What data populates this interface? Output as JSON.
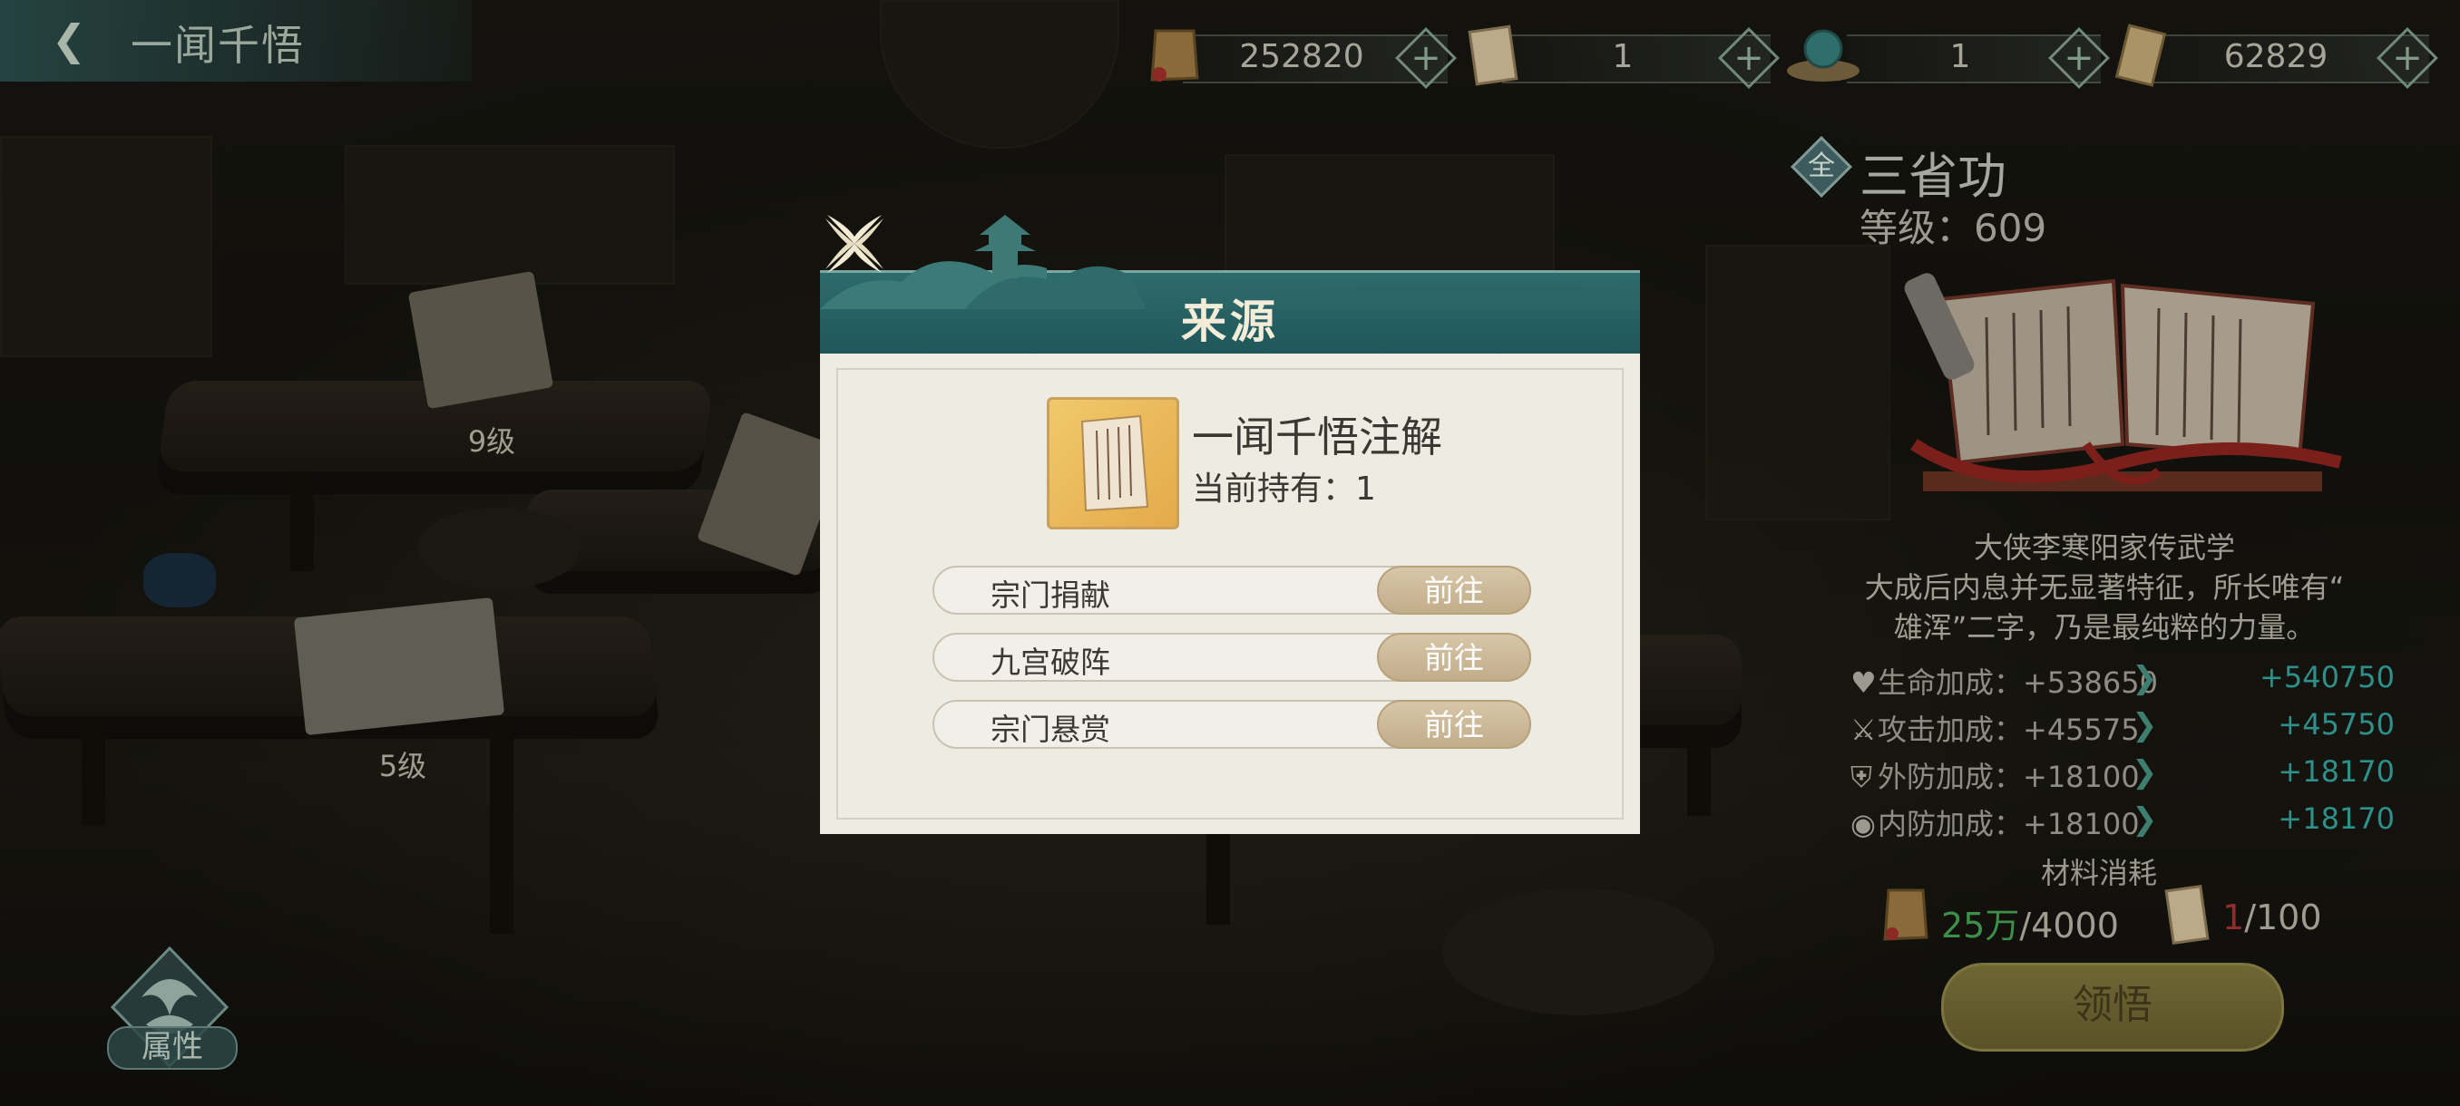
{
  "header": {
    "title": "一闻千悟"
  },
  "currencies": [
    {
      "icon": "seal-token-icon",
      "value": "252820"
    },
    {
      "icon": "scroll-note-icon",
      "value": "1"
    },
    {
      "icon": "jade-artifact-icon",
      "value": "1"
    },
    {
      "icon": "manual-book-icon",
      "value": "62829"
    }
  ],
  "scene": {
    "item_levels": [
      "9级",
      "5级"
    ],
    "attr_label": "属性"
  },
  "kungfu": {
    "badge": "全",
    "name": "三省功",
    "level_text": "等级：609",
    "description": [
      "大侠李寒阳家传武学",
      "大成后内息并无显著特征，所长唯有“",
      "雄浑”二字，乃是最纯粹的力量。"
    ],
    "stats": [
      {
        "icon": "heart-icon",
        "label": "生命加成：+538650",
        "next": "+540750"
      },
      {
        "icon": "sword-icon",
        "label": "攻击加成：+45575",
        "next": "+45750"
      },
      {
        "icon": "shield-icon",
        "label": "外防加成：+18100",
        "next": "+18170"
      },
      {
        "icon": "inner-shield-icon",
        "label": "内防加成：+18100",
        "next": "+18170"
      }
    ],
    "materials_title": "材料消耗",
    "materials": [
      {
        "icon": "seal-token-icon",
        "have": "25万",
        "need": "/4000",
        "enough": true
      },
      {
        "icon": "scroll-note-icon",
        "have": "1",
        "need": "/100",
        "enough": false
      }
    ],
    "comprehend_label": "领悟"
  },
  "modal": {
    "title": "来源",
    "item_name": "一闻千悟注解",
    "owned_text": "当前持有：1",
    "sources": [
      {
        "name": "宗门捐献",
        "action": "前往"
      },
      {
        "name": "九宫破阵",
        "action": "前往"
      },
      {
        "name": "宗门悬赏",
        "action": "前往"
      }
    ]
  },
  "colors": {
    "modal_header": "#2e6b6d",
    "go_button": "#c2ad8a",
    "stat_next": "#2f8f8a",
    "enough": "#3e8f4a",
    "not_enough": "#8f2d2d"
  }
}
